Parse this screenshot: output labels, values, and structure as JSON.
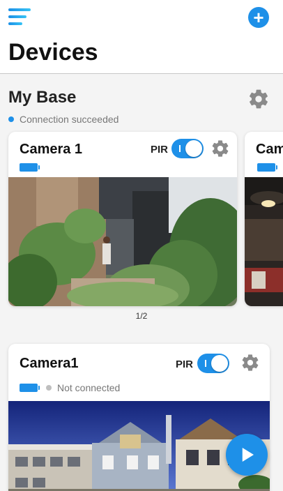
{
  "header": {
    "menu_icon": "hamburger-menu-icon",
    "add_icon": "plus-circle-icon",
    "title": "Devices"
  },
  "base": {
    "name": "My Base",
    "settings_icon": "gear-icon",
    "status_text": "Connection succeeded",
    "status_color": "#1e90e8"
  },
  "carousel": {
    "cards": [
      {
        "title": "Camera 1",
        "pir_label": "PIR",
        "pir_on": true,
        "battery_icon": "battery-full-icon"
      },
      {
        "title": "Cam"
      }
    ],
    "page_indicator": "1/2"
  },
  "camera_card": {
    "title": "Camera1",
    "pir_label": "PIR",
    "pir_on": true,
    "battery_icon": "battery-full-icon",
    "status_text": "Not connected",
    "status_color": "#bfbfbf",
    "play_icon": "play-icon"
  },
  "colors": {
    "accent": "#1e90e8",
    "background": "#f4f4f4"
  }
}
